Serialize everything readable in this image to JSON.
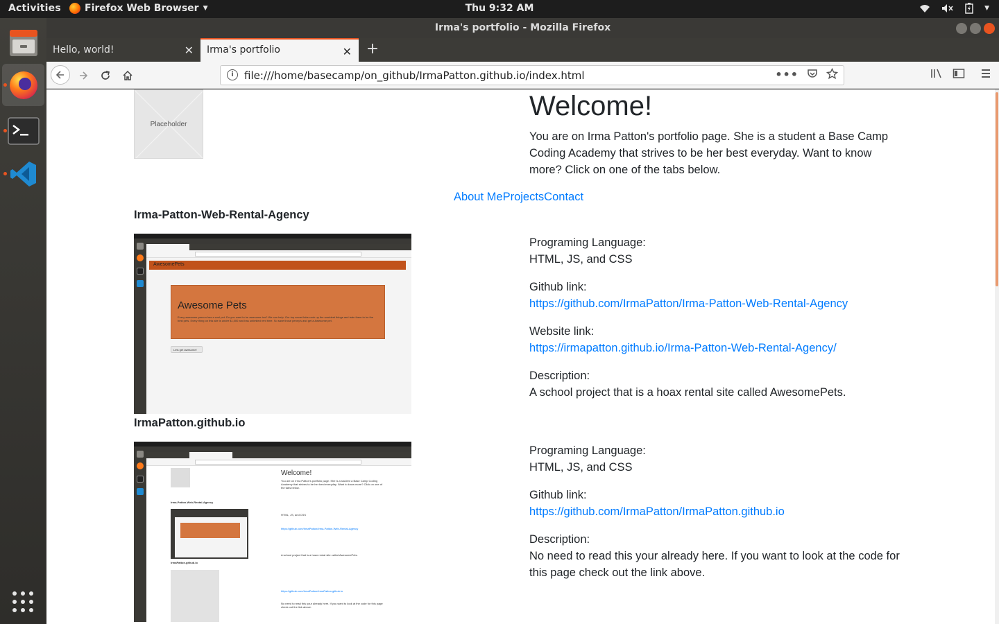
{
  "topbar": {
    "activities": "Activities",
    "app_name": "Firefox Web Browser",
    "clock": "Thu  9:32 AM"
  },
  "window": {
    "title": "Irma's portfolio - Mozilla Firefox"
  },
  "tabs": [
    {
      "label": "Hello, world!",
      "active": false
    },
    {
      "label": "Irma's portfolio",
      "active": true
    }
  ],
  "navbar": {
    "url": "file:///home/basecamp/on_github/IrmaPatton.github.io/index.html"
  },
  "page": {
    "placeholder_label": "Placeholder",
    "heading": "Welcome!",
    "intro": "You are on Irma Patton's portfolio page. She is a student a Base Camp Coding Academy that strives to be her best everyday. Want to know more? Click on one of the tabs below.",
    "nav": [
      "About Me",
      "Projects",
      "Contact"
    ],
    "projects": [
      {
        "title": "Irma-Patton-Web-Rental-Agency",
        "lang_label": "Programing Language:",
        "lang": "HTML, JS, and CSS",
        "github_label": "Github link:",
        "github": "https://github.com/IrmaPatton/Irma-Patton-Web-Rental-Agency",
        "website_label": "Website link:",
        "website": "https://irmapatton.github.io/Irma-Patton-Web-Rental-Agency/",
        "desc_label": "Description:",
        "desc": "A school project that is a hoax rental site called AwesomePets."
      },
      {
        "title": "IrmaPatton.github.io",
        "lang_label": "Programing Language:",
        "lang": "HTML, JS, and CSS",
        "github_label": "Github link:",
        "github": "https://github.com/IrmaPatton/IrmaPatton.github.io",
        "desc_label": "Description:",
        "desc": "No need to read this your already here. If you want to look at the code for this page check out the link above."
      }
    ],
    "shot1": {
      "brand": "AwesomePets",
      "hero_title": "Awesome Pets",
      "hero_text": "Every awesome person has a cool pet. Do you want to be awesome too? We can help. Our top secret labs cook up the wackiest things and train them to be the best pets. Every thing on this site is under $1,000 and has unlimited rent time. So save those penny's and get a Awesome pet.",
      "button": "Lets get awesome!"
    }
  },
  "colors": {
    "accent": "#e95420",
    "link": "#007bff",
    "hero": "#d4763f",
    "navbar_brand_bg": "#c1521b"
  }
}
